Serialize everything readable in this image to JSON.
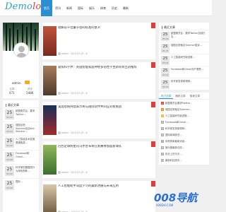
{
  "logo": {
    "a": "Demo",
    "b": "logo"
  },
  "nav": [
    "首页",
    "资讯",
    "新闻",
    "国际",
    "娱乐",
    "体育",
    "历史",
    "最新"
  ],
  "profile": {
    "name": "admin",
    "stats": [
      {
        "label": "文章",
        "value": "471"
      },
      {
        "label": "浏览",
        "value": "5486"
      }
    ]
  },
  "left_list": {
    "title": "最近文章",
    "items": [
      {
        "day": "25",
        "mon": "05-09",
        "text": "欧盟委员会：要求Twitter…"
      },
      {
        "day": "25",
        "mon": "05-09",
        "text": "德国法院：Starmer回应Keir Starmer…"
      },
      {
        "day": "25",
        "mon": "05-09",
        "text": "人工智能技术发展遭遇瓶颈…"
      },
      {
        "day": "25",
        "mon": "05-09",
        "text": "Facebook和Gmail…"
      },
      {
        "day": "25",
        "mon": "05-09",
        "text": "科学家把猩猩提升为濒危物种…"
      },
      {
        "day": "25",
        "mon": "05-09",
        "text": "国际…"
      }
    ]
  },
  "posts": [
    {
      "title": "理解前十位量子密码标准的意义",
      "author": "admin",
      "date": "2023-05-25",
      "views": "6"
    },
    {
      "title": "震惊科学界：英国智能家居神经多倍性学生新项目立药推荐",
      "author": "admin",
      "date": "2023-05-25",
      "views": "6"
    },
    {
      "title": "美国总统拜登表示将与国际伙伴共同应对新挑战",
      "author": "admin",
      "date": "2023-05-25",
      "views": "6"
    },
    {
      "title": "巴西足球明星内马尔宣布将在新赛季加盟新球队",
      "author": "admin",
      "date": "2023-05-25",
      "views": "6"
    },
    {
      "title": "人工智能助手深度学习的最新进展与未来应用",
      "author": "admin",
      "date": "2023-05-25",
      "views": "6"
    }
  ],
  "right_recent": {
    "title": "最近文章",
    "items": [
      {
        "day": "25",
        "mon": "05-09",
        "text": "欧盟委员会：要求Twitter加强打击…"
      },
      {
        "day": "25",
        "mon": "05-09",
        "text": "德国法院裁定Starmer胜诉…"
      },
      {
        "day": "25",
        "mon": "05-09",
        "text": "人工智能研究新进展…"
      },
      {
        "day": "25",
        "mon": "05-09",
        "text": "Facebook和Gmail用户遭受…"
      },
      {
        "day": "25",
        "mon": "05-09",
        "text": "科学家发现新物种…"
      }
    ]
  },
  "tabs": [
    "热门文章",
    "随机文章",
    "推荐文章"
  ],
  "rank": [
    "欧盟委员会要求Twitter…",
    "德国法院裁定Starmer…",
    "人工智能研究新进展…",
    "Facebook和Gmail…",
    "科学家发现新物种…",
    "国际新闻综述…",
    "体育赛事最新消息…",
    "娱乐圈最新动态…",
    "历史上的今天…",
    "最新科技资讯…"
  ],
  "watermark": {
    "big": "008导航",
    "small": "008DH.COM"
  }
}
